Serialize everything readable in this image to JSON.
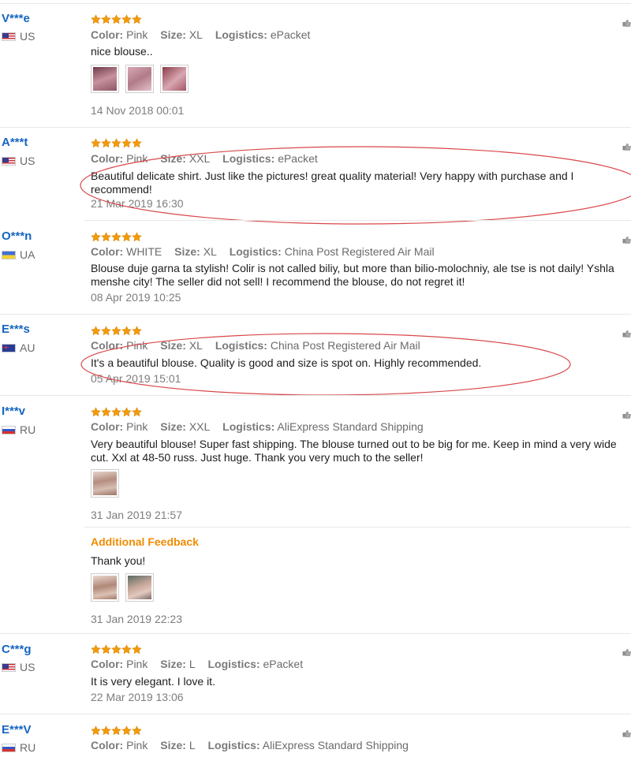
{
  "labels": {
    "color": "Color:",
    "size": "Size:",
    "logistics": "Logistics:",
    "additional_feedback": "Additional Feedback"
  },
  "rating_icon": "star-icon",
  "accent_colors": {
    "username": "#1665c0",
    "stars": "#f29b0a",
    "additional": "#f08c00",
    "annotation": "#d9474a"
  },
  "reviews": [
    {
      "user": "V***e",
      "country": "US",
      "stars": 5,
      "color": "Pink",
      "size": "XL",
      "logistics": "ePacket",
      "text": "nice blouse..",
      "photos": 3,
      "date": "14 Nov 2018 00:01"
    },
    {
      "user": "A***t",
      "country": "US",
      "stars": 5,
      "color": "Pink",
      "size": "XXL",
      "logistics": "ePacket",
      "text": "Beautiful delicate shirt. Just like the pictures! great quality material! Very happy with purchase and I recommend!",
      "date": "21 Mar 2019 16:30",
      "highlighted": true
    },
    {
      "user": "O***n",
      "country": "UA",
      "stars": 5,
      "color": "WHITE",
      "size": "XL",
      "logistics": "China Post Registered Air Mail",
      "text": "Blouse duje garna ta stylish! Colir is not called biliy, but more than bilio-molochniy, ale tse is not daily! Yshla menshe city! The seller did not sell! I recommend the blouse, do not regret it!",
      "date": "08 Apr 2019 10:25"
    },
    {
      "user": "E***s",
      "country": "AU",
      "stars": 5,
      "color": "Pink",
      "size": "XL",
      "logistics": "China Post Registered Air Mail",
      "text": "It's a beautiful blouse. Quality is good and size is spot on. Highly recommended.",
      "date": "05 Apr 2019 15:01",
      "highlighted": true
    },
    {
      "user": "I***v",
      "country": "RU",
      "stars": 5,
      "color": "Pink",
      "size": "XXL",
      "logistics": "AliExpress Standard Shipping",
      "text": "Very beautiful blouse! Super fast shipping. The blouse turned out to be big for me. Keep in mind a very wide cut. Xxl at 48-50 russ. Just huge. Thank you very much to the seller!",
      "photos": 1,
      "date": "31 Jan 2019 21:57",
      "additional": {
        "text": "Thank you!",
        "photos": 2,
        "date": "31 Jan 2019 22:23"
      }
    },
    {
      "user": "C***g",
      "country": "US",
      "stars": 5,
      "color": "Pink",
      "size": "L",
      "logistics": "ePacket",
      "text": "It is very elegant. I love it.",
      "date": "22 Mar 2019 13:06"
    },
    {
      "user": "E***V",
      "country": "RU",
      "stars": 5,
      "color": "Pink",
      "size": "L",
      "logistics": "AliExpress Standard Shipping"
    }
  ]
}
